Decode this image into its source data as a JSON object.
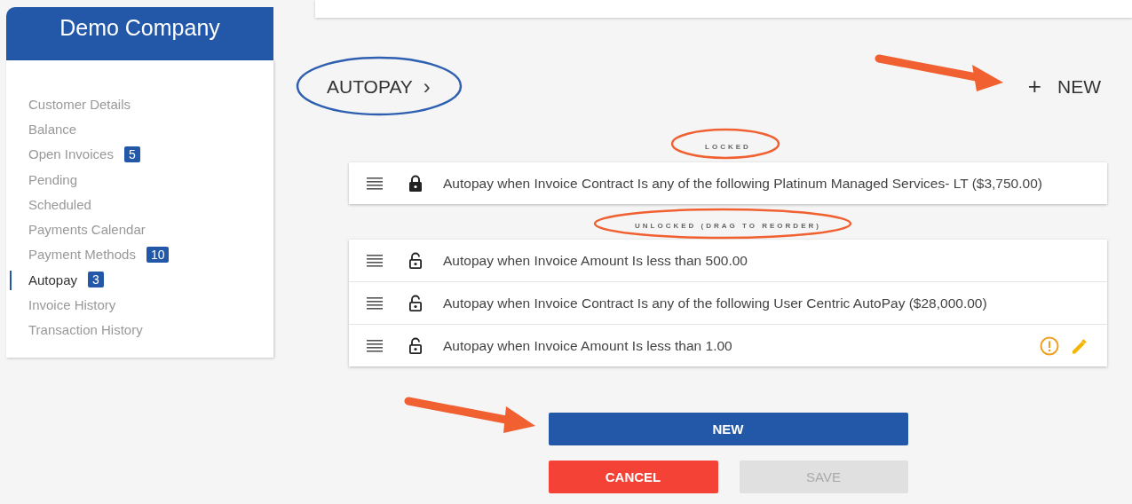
{
  "sidebar": {
    "company": "Demo Company",
    "items": [
      {
        "label": "Customer Details",
        "selected": false
      },
      {
        "label": "Balance",
        "selected": false
      },
      {
        "label": "Open Invoices",
        "badge": "5",
        "selected": false
      },
      {
        "label": "Pending",
        "selected": false
      },
      {
        "label": "Scheduled",
        "selected": false
      },
      {
        "label": "Payments Calendar",
        "selected": false
      },
      {
        "label": "Payment Methods",
        "badge": "10",
        "selected": false
      },
      {
        "label": "Autopay",
        "badge": "3",
        "selected": true
      },
      {
        "label": "Invoice History",
        "selected": false
      },
      {
        "label": "Transaction History",
        "selected": false
      }
    ]
  },
  "header": {
    "title": "AUTOPAY",
    "chevron": "›",
    "new_link": {
      "icon": "+",
      "label": "NEW"
    }
  },
  "sections": [
    {
      "label": "LOCKED",
      "rules": [
        {
          "text": "Autopay when Invoice Contract Is any of the following Platinum Managed Services- LT ($3,750.00)",
          "locked": true,
          "warning": false,
          "editable": false
        }
      ]
    },
    {
      "label": "UNLOCKED (DRAG TO REORDER)",
      "rules": [
        {
          "text": "Autopay when Invoice Amount Is less than 500.00",
          "locked": false,
          "warning": false,
          "editable": false
        },
        {
          "text": "Autopay when Invoice Contract Is any of the following User Centric AutoPay ($28,000.00)",
          "locked": false,
          "warning": false,
          "editable": false
        },
        {
          "text": "Autopay when Invoice Amount Is less than 1.00",
          "locked": false,
          "warning": true,
          "editable": true
        }
      ]
    }
  ],
  "buttons": {
    "new": {
      "label": "NEW"
    },
    "cancel": {
      "label": "CANCEL"
    },
    "save": {
      "label": "SAVE",
      "disabled": true
    }
  }
}
